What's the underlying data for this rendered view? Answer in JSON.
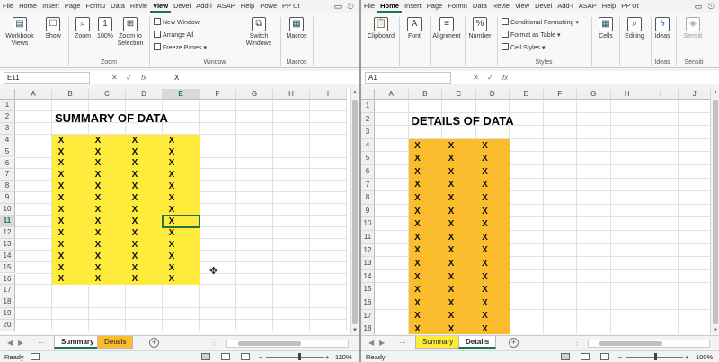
{
  "left_window": {
    "ribbon_tabs": [
      "File",
      "Home",
      "Insert",
      "Page",
      "Formu",
      "Data",
      "Revie",
      "View",
      "Devel",
      "Add-i",
      "ASAP",
      "Help",
      "Powe",
      "PP Ut"
    ],
    "active_tab": "View",
    "ribbon": {
      "workbook_views": "Workbook Views",
      "show": "Show",
      "zoom": "Zoom",
      "zoom_100": "100%",
      "zoom_to_selection": "Zoom to Selection",
      "new_window": "New Window",
      "arrange_all": "Arrange All",
      "freeze_panes": "Freeze Panes",
      "switch_windows": "Switch Windows",
      "macros": "Macros",
      "group_zoom": "Zoom",
      "group_window": "Window",
      "group_macros": "Macros"
    },
    "name_box": "E11",
    "formula": "X",
    "columns": [
      "A",
      "B",
      "C",
      "D",
      "E",
      "F",
      "G",
      "H",
      "I"
    ],
    "rows": [
      "1",
      "2",
      "3",
      "4",
      "5",
      "6",
      "7",
      "8",
      "9",
      "10",
      "11",
      "12",
      "13",
      "14",
      "15",
      "16",
      "17",
      "18",
      "19",
      "20"
    ],
    "title": "SUMMARY OF DATA",
    "cell_value": "X",
    "fill_color": "#ffeb3b",
    "sheet_tabs": [
      "Summary",
      "Details"
    ],
    "active_sheet": "Summary",
    "status_ready": "Ready",
    "zoom_level": "110%"
  },
  "right_window": {
    "ribbon_tabs": [
      "File",
      "Home",
      "Insert",
      "Page",
      "Formu",
      "Data",
      "Revie",
      "View",
      "Devel",
      "Add-i",
      "ASAP",
      "Help",
      "PP Ut"
    ],
    "active_tab": "Home",
    "ribbon": {
      "clipboard": "Clipboard",
      "font": "Font",
      "alignment": "Alignment",
      "number": "Number",
      "conditional_formatting": "Conditional Formatting",
      "format_as_table": "Format as Table",
      "cell_styles": "Cell Styles",
      "cells": "Cells",
      "editing": "Editing",
      "ideas": "Ideas",
      "sensitivity": "Sensiti",
      "group_styles": "Styles",
      "group_ideas": "Ideas",
      "group_sensitivity": "Sensiti"
    },
    "name_box": "A1",
    "formula": "",
    "columns": [
      "A",
      "B",
      "C",
      "D",
      "E",
      "F",
      "G",
      "H",
      "I",
      "J"
    ],
    "rows": [
      "1",
      "2",
      "3",
      "4",
      "5",
      "6",
      "7",
      "8",
      "9",
      "10",
      "11",
      "12",
      "13",
      "14",
      "15",
      "16",
      "17",
      "18"
    ],
    "title": "DETAILS OF DATA",
    "cell_value": "X",
    "fill_color": "#fbbd2e",
    "sheet_tabs": [
      "Summary",
      "Details"
    ],
    "active_sheet": "Details",
    "status_ready": "Ready",
    "zoom_level": "100%"
  },
  "colors": {
    "accent": "#217346",
    "summary_tab": "#ffeb3b",
    "details_tab": "#fbbd2e"
  }
}
